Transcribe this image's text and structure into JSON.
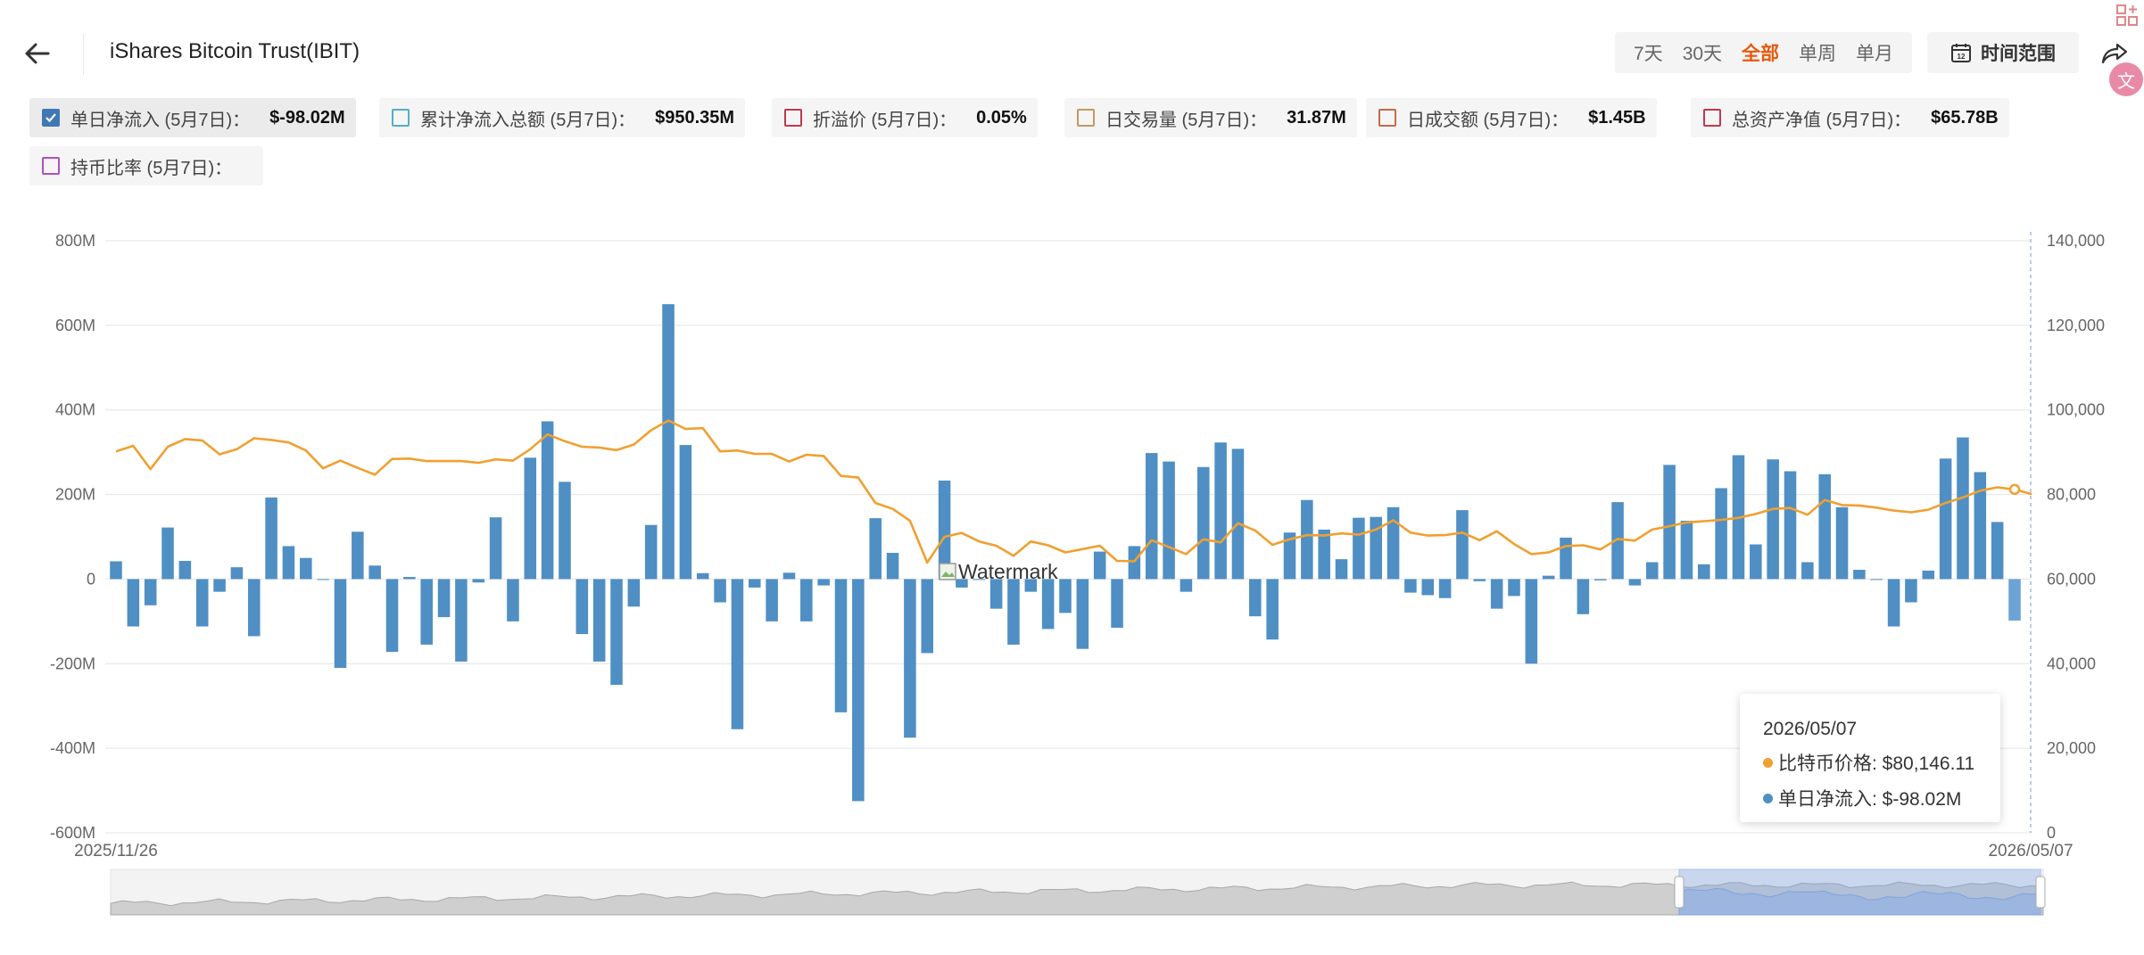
{
  "header": {
    "title": "iShares Bitcoin Trust(IBIT)",
    "ranges": [
      {
        "label": "7天",
        "active": false
      },
      {
        "label": "30天",
        "active": false
      },
      {
        "label": "全部",
        "active": true
      },
      {
        "label": "单周",
        "active": false
      },
      {
        "label": "单月",
        "active": false
      }
    ],
    "time_range_label": "时间范围"
  },
  "metrics": [
    {
      "label": "单日净流入 (5月7日)：",
      "value": "$-98.02M",
      "checked": true,
      "color": "#3f78b4"
    },
    {
      "label": "累计净流入总额 (5月7日)：",
      "value": "$950.35M",
      "checked": false,
      "color": "#4fb0c6"
    },
    {
      "label": "折溢价 (5月7日)：",
      "value": "0.05%",
      "checked": false,
      "color": "#c0384f"
    },
    {
      "label": "日交易量 (5月7日)：",
      "value": "31.87M",
      "checked": false,
      "color": "#c49a5a"
    },
    {
      "label": "日成交额 (5月7日)：",
      "value": "$1.45B",
      "checked": false,
      "color": "#c46a4a"
    },
    {
      "label": "总资产净值 (5月7日)：",
      "value": "$65.78B",
      "checked": false,
      "color": "#c0384f"
    },
    {
      "label": "持币比率 (5月7日)：",
      "value": "",
      "checked": false,
      "color": "#b04fc0"
    }
  ],
  "tooltip": {
    "date": "2026/05/07",
    "line1": "比特币价格: $80,146.11",
    "line2": "单日净流入: $-98.02M",
    "color1": "#f0a030",
    "color2": "#4f8fc4"
  },
  "watermark": "Watermark",
  "chart_data": {
    "type": "bar",
    "x_start_label": "2025/11/26",
    "x_end_label": "2026/05/07",
    "left_axis": {
      "ticks": [
        "800M",
        "600M",
        "400M",
        "200M",
        "0",
        "-200M",
        "-400M",
        "-600M"
      ],
      "min": -600,
      "max": 800,
      "unit": "M"
    },
    "right_axis": {
      "ticks": [
        "140,000",
        "120,000",
        "100,000",
        "80,000",
        "60,000",
        "40,000",
        "20,000",
        "0"
      ],
      "min": 0,
      "max": 140000
    },
    "grid": true,
    "bar_color": "#4f8fc4",
    "line_color": "#f0a030",
    "series": [
      {
        "name": "单日净流入",
        "values": [
          42,
          -112,
          -62,
          122,
          43,
          -112,
          -30,
          28,
          -135,
          193,
          78,
          50,
          0,
          -210,
          112,
          32,
          -172,
          5,
          -155,
          -90,
          -195,
          -8,
          146,
          -100,
          287,
          373,
          230,
          -130,
          -195,
          -250,
          -65,
          128,
          650,
          317,
          14,
          -55,
          -355,
          -20,
          -100,
          15,
          -100,
          -15,
          -315,
          -525,
          144,
          62,
          -375,
          -175,
          233,
          -20,
          0,
          -70,
          -155,
          -30,
          -118,
          -80,
          -165,
          65,
          -115,
          78,
          298,
          278,
          -30,
          265,
          323,
          308,
          -88,
          -143,
          110,
          187,
          117,
          47,
          145,
          147,
          170,
          -32,
          -38,
          -45,
          163,
          -5,
          -70,
          -40,
          -200,
          8,
          98,
          -83,
          -3,
          182,
          -15,
          40,
          270,
          138,
          35,
          215,
          293,
          82,
          283,
          255,
          40,
          248,
          170,
          22,
          0,
          -112,
          -55,
          20,
          285,
          335,
          253,
          135,
          -98
        ]
      },
      {
        "name": "比特币价格",
        "values": [
          90200,
          91500,
          86000,
          91300,
          93100,
          92800,
          89500,
          90700,
          93300,
          92900,
          92300,
          90400,
          86200,
          88000,
          86300,
          84700,
          88400,
          88500,
          87900,
          87900,
          87900,
          87500,
          88300,
          88000,
          90700,
          94200,
          92600,
          91300,
          91100,
          90500,
          91800,
          95200,
          97500,
          95500,
          95700,
          90200,
          90400,
          89600,
          89600,
          87800,
          89400,
          89100,
          84400,
          84000,
          78000,
          76600,
          73800,
          63900,
          70000,
          70900,
          68900,
          67900,
          65500,
          68900,
          68000,
          66300,
          67100,
          67900,
          64300,
          64200,
          69200,
          67600,
          65900,
          69400,
          68700,
          73200,
          71500,
          68100,
          69400,
          70400,
          70300,
          70800,
          70500,
          71700,
          73900,
          71000,
          70300,
          70400,
          71000,
          69200,
          71300,
          68300,
          65900,
          66300,
          67800,
          68000,
          67000,
          69500,
          69100,
          71700,
          72500,
          73400,
          73700,
          74000,
          74500,
          75400,
          76600,
          76800,
          75200,
          78700,
          77500,
          77400,
          76900,
          76200,
          75800,
          76400,
          78000,
          79300,
          80900,
          81700,
          81200,
          80100
        ]
      }
    ]
  }
}
